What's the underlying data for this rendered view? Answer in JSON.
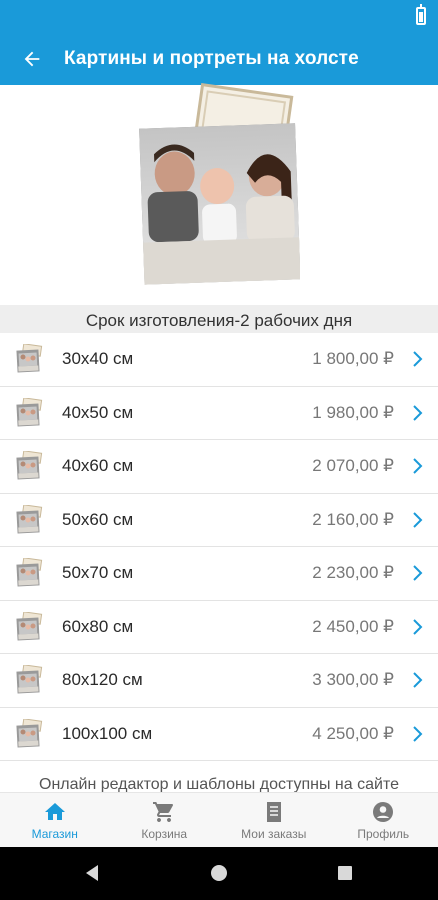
{
  "header": {
    "title": "Картины и портреты на холсте",
    "back_icon": "arrow-left-icon"
  },
  "colors": {
    "primary": "#1a9ad9",
    "text": "#333333",
    "price": "#777777",
    "nav_inactive": "#7a7a7a"
  },
  "hero": {
    "image": "canvas-family-portrait"
  },
  "section": {
    "header": "Срок изготовления-2 рабочих дня"
  },
  "products": [
    {
      "size": "30х40 см",
      "price": "1 800,00 ₽"
    },
    {
      "size": "40х50 см",
      "price": "1 980,00 ₽"
    },
    {
      "size": "40х60 см",
      "price": "2 070,00 ₽"
    },
    {
      "size": "50х60 см",
      "price": "2 160,00 ₽"
    },
    {
      "size": "50х70 см",
      "price": "2 230,00 ₽"
    },
    {
      "size": "60х80 см",
      "price": "2 450,00 ₽"
    },
    {
      "size": "80х120 см",
      "price": "3 300,00 ₽"
    },
    {
      "size": "100х100 см",
      "price": "4 250,00 ₽"
    }
  ],
  "footer": {
    "text": "Онлайн редактор и шаблоны доступны на сайте"
  },
  "bottom_nav": [
    {
      "label": "Магазин",
      "icon": "home-icon",
      "active": true
    },
    {
      "label": "Корзина",
      "icon": "cart-icon",
      "active": false
    },
    {
      "label": "Мои заказы",
      "icon": "orders-icon",
      "active": false
    },
    {
      "label": "Профиль",
      "icon": "profile-icon",
      "active": false
    }
  ]
}
